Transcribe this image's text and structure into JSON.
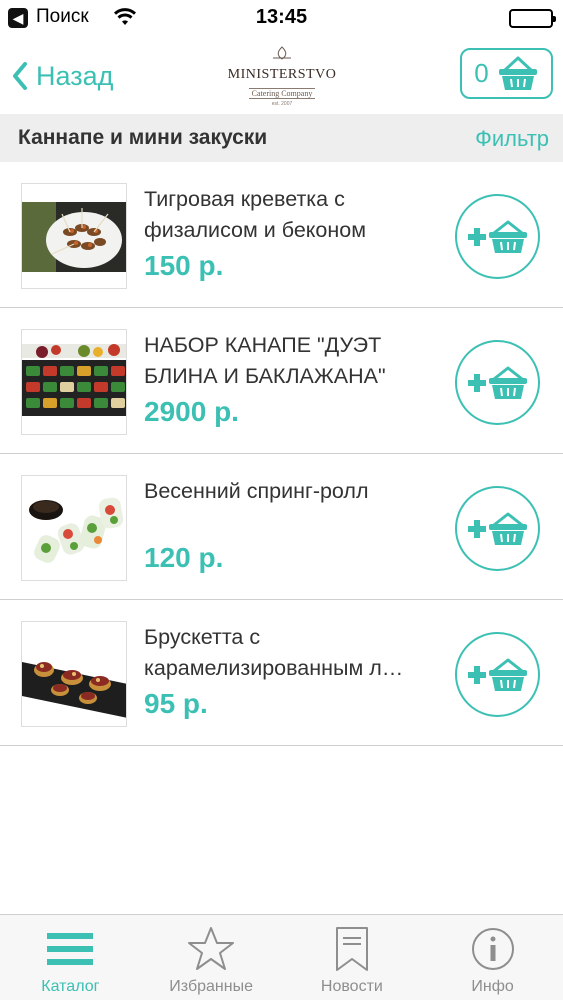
{
  "status_bar": {
    "back_glyph": "◀",
    "carrier": "Поиск",
    "time": "13:45"
  },
  "nav": {
    "back_label": "Назад",
    "logo_title": "MINISTERSTVO",
    "logo_subtitle": "Catering Company",
    "logo_est": "est. 2007",
    "cart_count": "0"
  },
  "section": {
    "title": "Каннапе и мини закуски",
    "filter_label": "Фильтр"
  },
  "products": [
    {
      "name": "Тигровая креветка с физалисом и беконом",
      "price": "150 р."
    },
    {
      "name": "НАБОР КАНАПЕ \"ДУЭТ БЛИНА И БАКЛАЖАНА\"",
      "price": "2900 р."
    },
    {
      "name": "Весенний спринг-ролл",
      "price": "120 р."
    },
    {
      "name": "Брускетта с карамелизированным л…",
      "price": "95 р."
    }
  ],
  "tabs": [
    {
      "label": "Каталог",
      "icon": "menu-icon",
      "active": true
    },
    {
      "label": "Избранные",
      "icon": "star-icon",
      "active": false
    },
    {
      "label": "Новости",
      "icon": "bookmark-icon",
      "active": false
    },
    {
      "label": "Инфо",
      "icon": "info-icon",
      "active": false
    }
  ],
  "colors": {
    "accent": "#3cc0b4",
    "section_bg": "#eeeeee",
    "tab_inactive": "#8e8e8e"
  }
}
